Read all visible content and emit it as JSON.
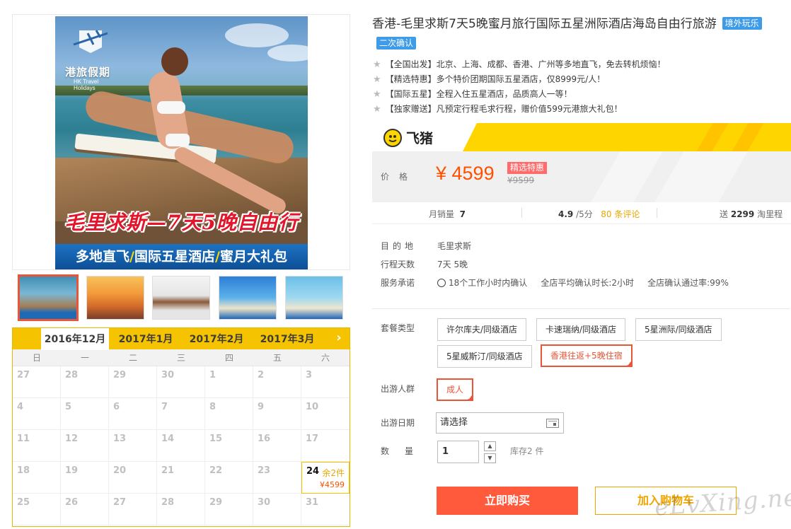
{
  "gallery": {
    "logo_text": "港旅假期",
    "logo_sub": "HK Travel Holidays",
    "banner_title": "毛里求斯—7天5晚自由行",
    "banner_strip": [
      "多地直飞",
      "国际五星酒店",
      "蜜月大礼包"
    ]
  },
  "calendar": {
    "months": [
      "2016年12月",
      "2017年1月",
      "2017年2月",
      "2017年3月"
    ],
    "active_month": "2016年12月",
    "next_icon": "chevron-right-icon",
    "weekdays": [
      "日",
      "一",
      "二",
      "三",
      "四",
      "五",
      "六"
    ],
    "days": [
      [
        "27",
        "28",
        "29",
        "30",
        "1",
        "2",
        "3"
      ],
      [
        "4",
        "5",
        "6",
        "7",
        "8",
        "9",
        "10"
      ],
      [
        "11",
        "12",
        "13",
        "14",
        "15",
        "16",
        "17"
      ],
      [
        "18",
        "19",
        "20",
        "21",
        "22",
        "23",
        "24"
      ],
      [
        "25",
        "26",
        "27",
        "28",
        "29",
        "30",
        "31"
      ]
    ],
    "available_day": {
      "day": "24",
      "stock": "余2件",
      "price": "¥4599"
    }
  },
  "product": {
    "title": "香港-毛里求斯7天5晚蜜月旅行国际五星洲际酒店海岛自由行旅游",
    "tag_overseas": "境外玩乐",
    "tag_confirm": "二次确认",
    "features": [
      "【全国出发】北京、上海、成都、香港、广州等多地直飞，免去转机烦恼！",
      "【精选特惠】多个特价团期国际五星酒店，仅8999元/人！",
      "【国际五星】全程入住五星酒店，品质高人一等！",
      "【独家赠送】凡预定行程毛求行程，赠价值599元港旅大礼包！"
    ]
  },
  "brand": {
    "name": "飞猪"
  },
  "price": {
    "label": "价格",
    "current": "¥ 4599",
    "badge": "精选特惠",
    "original": "¥9599"
  },
  "stats": {
    "monthly_sales_label": "月销量",
    "monthly_sales": "7",
    "rating": "4.9",
    "rating_suffix": "/5分",
    "reviews": "80 条评论",
    "points_prefix": "送",
    "points": "2299",
    "points_suffix": "淘里程"
  },
  "info": {
    "destination_label": "目的地",
    "destination": "毛里求斯",
    "days_label": "行程天数",
    "days": "7天 5晚",
    "service_label": "服务承诺",
    "service_items": [
      "18个工作小时内确认",
      "全店平均确认时长:2小时",
      "全店确认通过率:99%"
    ]
  },
  "options": {
    "package_label": "套餐类型",
    "packages": [
      "许尔库夫/同级酒店",
      "卡速瑞纳/同级酒店",
      "5星洲际/同级酒店",
      "5星威斯汀/同级酒店",
      "香港往返+5晚住宿"
    ],
    "selected_package": "香港往返+5晚住宿",
    "people_label": "出游人群",
    "people": [
      "成人"
    ],
    "date_label": "出游日期",
    "date_placeholder": "请选择",
    "qty_label": "数量",
    "qty_value": "1",
    "stock": "库存2 件"
  },
  "actions": {
    "buy_now": "立即购买",
    "add_cart": "加入购物车"
  },
  "watermark": "eLvXing.net",
  "colors": {
    "accent_red": "#ff5000",
    "selected_border": "#e85537",
    "fliggy_yellow": "#ffd500",
    "tag_blue": "#3e9be8"
  }
}
